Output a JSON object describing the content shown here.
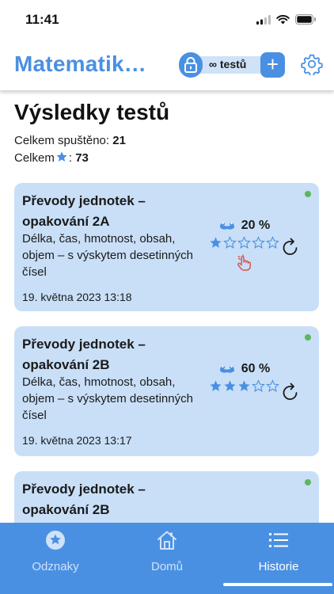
{
  "status_bar": {
    "time": "11:41"
  },
  "header": {
    "app_title": "Matematik…",
    "test_pill_label": "∞ testů",
    "plus_label": "+"
  },
  "page": {
    "title": "Výsledky testů",
    "stats": {
      "runs_label": "Celkem spuštěno:",
      "runs_value": "21",
      "stars_prefix": "Celkem",
      "stars_suffix": ":",
      "stars_value": "73"
    }
  },
  "results": [
    {
      "title": "Převody jednotek – opakování 2A",
      "description": "Délka, čas, hmotnost, obsah, objem – s výskytem desetinných čísel",
      "date": "19. května 2023 13:18",
      "percent": "20 %",
      "stars": 1,
      "stars_max": 5,
      "status_color": "#5cb85c"
    },
    {
      "title": "Převody jednotek – opakování 2B",
      "description": "Délka, čas, hmotnost, obsah, objem – s výskytem desetinných čísel",
      "date": "19. května 2023 13:17",
      "percent": "60 %",
      "stars": 3,
      "stars_max": 5,
      "status_color": "#5cb85c"
    },
    {
      "title": "Převody jednotek – opakování 2B",
      "status_color": "#5cb85c"
    }
  ],
  "tabs": [
    {
      "label": "Odznaky",
      "icon": "badge-star-icon",
      "active": false
    },
    {
      "label": "Domů",
      "icon": "home-icon",
      "active": false
    },
    {
      "label": "Historie",
      "icon": "list-icon",
      "active": true
    }
  ],
  "colors": {
    "accent": "#4a90e2",
    "card_bg": "#c8dff7",
    "status_green": "#5cb85c",
    "hand_red": "#d9534f"
  }
}
